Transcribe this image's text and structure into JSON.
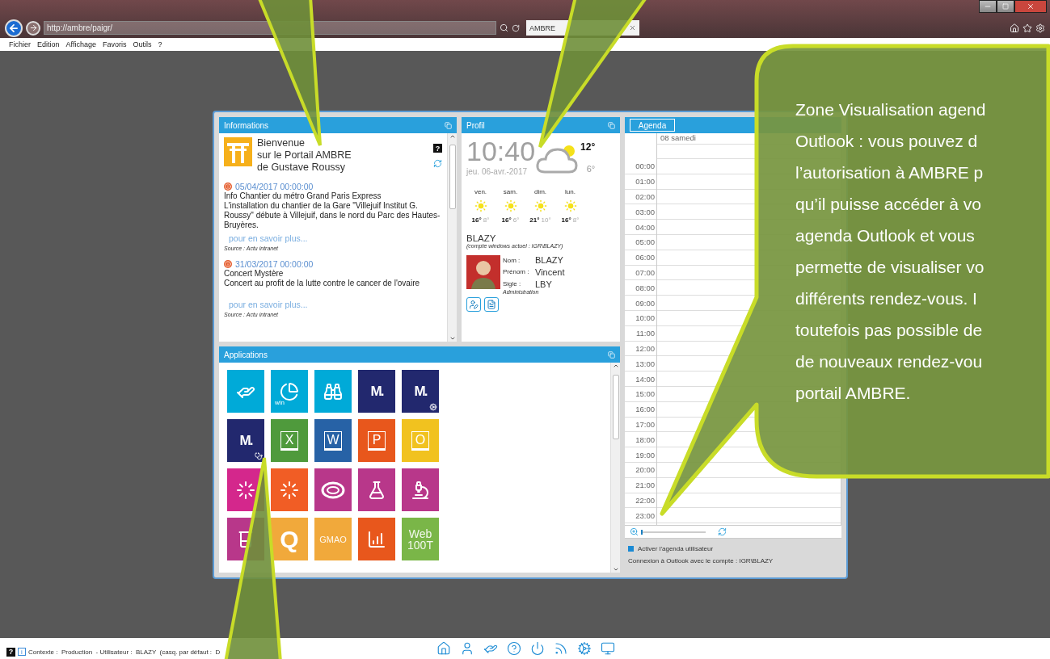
{
  "browser": {
    "address": "http://ambre/paigr/",
    "tab_title": "AMBRE",
    "menu": [
      "Fichier",
      "Edition",
      "Affichage",
      "Favoris",
      "Outils",
      "?"
    ]
  },
  "informations": {
    "title": "Informations",
    "welcome": [
      "Bienvenue",
      "sur le Portail AMBRE",
      "de Gustave Roussy"
    ],
    "help": "?",
    "news": [
      {
        "date": "05/04/2017 00:00:00",
        "title": "Info Chantier du métro Grand Paris Express",
        "body": "L'installation du chantier de la Gare \"Villejuif Institut G. Roussy\" débute à Villejuif, dans le nord du Parc des Hautes-Bruyères.",
        "link": "pour en savoir plus...",
        "source": "Source : Actu intranet"
      },
      {
        "date": "31/03/2017 00:00:00",
        "title": "Concert Mystère",
        "body": "Concert au profit de la lutte contre le cancer de l'ovaire",
        "link": "pour en savoir plus...",
        "source": "Source : Actu intranet"
      }
    ]
  },
  "profil": {
    "title": "Profil",
    "time": "10:40",
    "date": "jeu. 06-avr.-2017",
    "temp_high": "12°",
    "temp_low": "6°",
    "forecast": [
      {
        "day": "ven.",
        "high": "16°",
        "low": "8°"
      },
      {
        "day": "sam.",
        "high": "16°",
        "low": "6°"
      },
      {
        "day": "dim.",
        "high": "21°",
        "low": "10°"
      },
      {
        "day": "lun.",
        "high": "16°",
        "low": "8°"
      }
    ],
    "user": "BLAZY",
    "account": "(compte windows actuel : IGR\\BLAZY)",
    "fields": [
      {
        "label": "Nom :",
        "value": "BLAZY"
      },
      {
        "label": "Prénom :",
        "value": "Vincent"
      },
      {
        "label": "Sigle :",
        "value": "LBY"
      }
    ],
    "department": "Administration"
  },
  "agenda": {
    "tab": "Agenda",
    "day": "08 samedi",
    "hours": [
      "00:00",
      "01:00",
      "02:00",
      "03:00",
      "04:00",
      "05:00",
      "06:00",
      "07:00",
      "08:00",
      "09:00",
      "10:00",
      "11:00",
      "12:00",
      "13:00",
      "14:00",
      "15:00",
      "16:00",
      "17:00",
      "18:00",
      "19:00",
      "20:00",
      "21:00",
      "22:00",
      "23:00"
    ],
    "zoom": {
      "level": 0.03
    },
    "activate": {
      "label": "Activer l'agenda utilisateur",
      "checked": true
    },
    "connection": "Connexion à Outlook avec le compte : IGR\\BLAZY"
  },
  "applications": {
    "title": "Applications",
    "tiles": [
      {
        "kind": "icon",
        "color": "#00aad8"
      },
      {
        "kind": "icon",
        "color": "#00aad8",
        "label": "win"
      },
      {
        "kind": "icon",
        "color": "#00aad8"
      },
      {
        "kind": "logo",
        "color": "#22286e",
        "label": "M."
      },
      {
        "kind": "logo",
        "color": "#22286e",
        "label": "M."
      },
      {
        "kind": "logo",
        "color": "#22286e",
        "label": "M."
      },
      {
        "kind": "document",
        "color": "#4f9a3c",
        "label": "X"
      },
      {
        "kind": "document",
        "color": "#2762a6",
        "label": "W"
      },
      {
        "kind": "document",
        "color": "#e8571c",
        "label": "P"
      },
      {
        "kind": "document",
        "color": "#f1c21f",
        "label": "O"
      },
      {
        "kind": "icon",
        "color": "#d4278c"
      },
      {
        "kind": "icon",
        "color": "#f15d25"
      },
      {
        "kind": "icon",
        "color": "#b8378a"
      },
      {
        "kind": "icon",
        "color": "#b8378a"
      },
      {
        "kind": "icon",
        "color": "#b8378a"
      },
      {
        "kind": "icon",
        "color": "#b8378a"
      },
      {
        "kind": "letter",
        "color": "#f1a93b",
        "label": "Q"
      },
      {
        "kind": "text",
        "color": "#f1a93b",
        "label": "GMAO"
      },
      {
        "kind": "icon",
        "color": "#e8571c"
      },
      {
        "kind": "text",
        "color": "#7ab648",
        "label": "Web 100T"
      }
    ]
  },
  "status_bar": {
    "help": "?",
    "info": "i",
    "context": "Contexte :  Production  - Utilisateur :  BLAZY  (casq. par défaut :  D"
  },
  "callout": {
    "lines": [
      "Zone Visualisation agend",
      "Outlook : vous pouvez d",
      "l’autorisation à AMBRE p",
      "qu’il puisse accéder à vo",
      "agenda Outlook et vous",
      "permette de visualiser vo",
      "différents rendez-vous. I",
      "toutefois pas possible de",
      "de nouveaux rendez-vou",
      "portail AMBRE."
    ]
  }
}
